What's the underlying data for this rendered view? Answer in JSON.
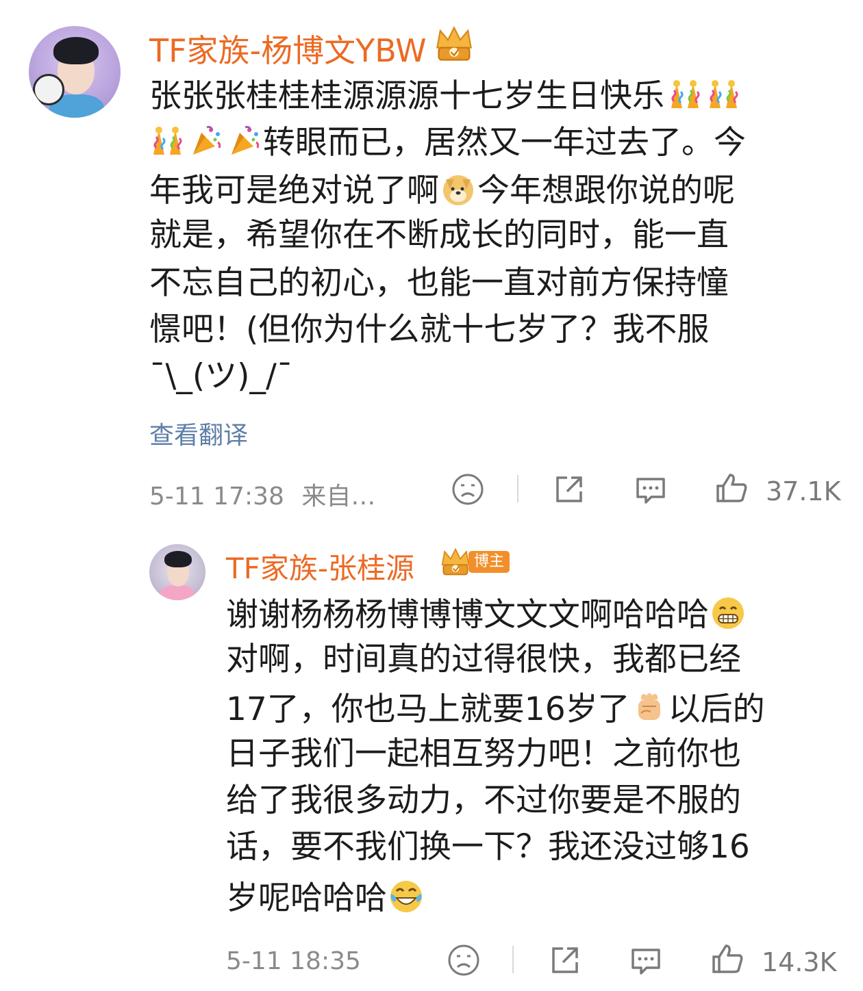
{
  "main_comment": {
    "username": "TF家族-杨博文YBW",
    "lines": [
      "张张张桂桂桂源源源十七岁生日快乐",
      "转眼而已，居然又一年过去了。今",
      "年我可是绝对说了啊",
      "今年想跟你说的呢",
      "就是，希望你在不断成长的同时，能一直",
      "不忘自己的初心，也能一直对前方保持憧",
      "憬吧！(但你为什么就十七岁了？我不服",
      "¯\\_(ツ)_/¯"
    ],
    "translate_label": "查看翻译",
    "timestamp": "5-11 17:38",
    "source": "来自…",
    "like_count": "37.1K"
  },
  "reply_comment": {
    "username": "TF家族-张桂源",
    "badge": "博主",
    "lines": [
      "谢谢杨杨杨博博博文文文啊哈哈哈",
      "对啊，时间真的过得很快，我都已经",
      "17了，你也马上就要16岁了",
      "以后的",
      "日子我们一起相互努力吧！之前你也",
      "给了我很多动力，不过你要是不服的",
      "话，要不我们换一下？我还没过够16",
      "岁呢哈哈哈"
    ],
    "timestamp": "5-11 18:35",
    "like_count": "14.3K"
  },
  "icons": {
    "emoji_main_1": "confetti-ball-icon",
    "emoji_main_2": "party-popper-icon",
    "emoji_main_3": "doge-icon",
    "emoji_reply_1": "grin-icon",
    "emoji_reply_2": "fist-icon",
    "emoji_reply_3": "laughing-tears-icon",
    "actions": [
      "dislike-face-icon",
      "share-icon",
      "comment-icon",
      "thumbs-up-icon"
    ]
  },
  "colors": {
    "username": "#ec6a24",
    "link": "#5d7fa8",
    "meta": "#8a8a8a",
    "badge": "#f28f2b"
  }
}
